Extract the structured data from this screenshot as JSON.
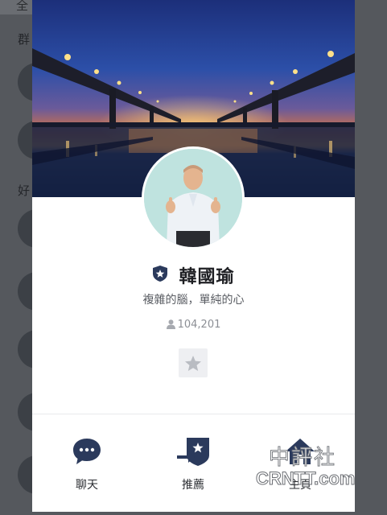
{
  "background": {
    "tab_label": "全",
    "section_groups": "群",
    "section_friends": "好"
  },
  "profile": {
    "name": "韓國瑜",
    "status_message": "複雜的腦，單純的心",
    "friend_count": "104,201",
    "official_badge_icon": "shield-star-icon",
    "favorite_icon": "star-icon"
  },
  "actions": [
    {
      "label": "聊天",
      "icon": "chat-bubble-icon"
    },
    {
      "label": "推薦",
      "icon": "recommend-icon"
    },
    {
      "label": "主頁",
      "icon": "home-icon"
    }
  ],
  "watermark": {
    "top": "中評社",
    "bottom": "CRNTT.com"
  },
  "colors": {
    "accent": "#2b3a5c",
    "icon_gray": "#b9bcc2",
    "text_dark": "#1e1f23"
  }
}
